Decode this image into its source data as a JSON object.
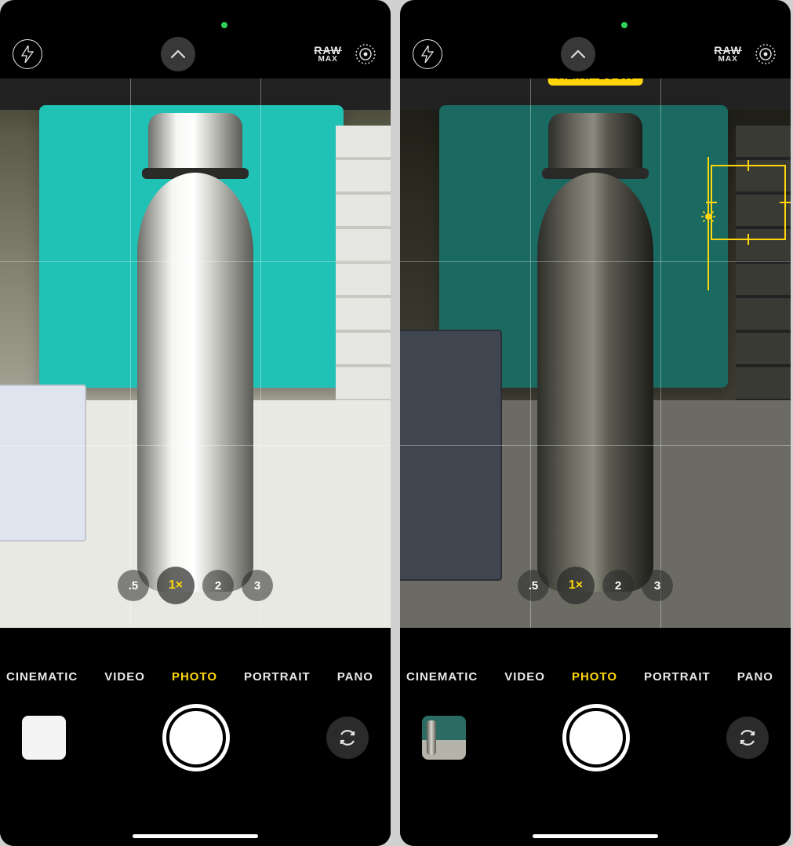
{
  "left": {
    "raw_top": "RAW",
    "raw_bottom": "MAX",
    "zoom": [
      ".5",
      "1×",
      "2",
      "3"
    ],
    "zoom_active_index": 1,
    "modes": [
      "CINEMATIC",
      "VIDEO",
      "PHOTO",
      "PORTRAIT",
      "PANO"
    ],
    "mode_active_index": 2,
    "aeaf_lock": false
  },
  "right": {
    "raw_top": "RAW",
    "raw_bottom": "MAX",
    "aeaf_label": "AE/AF LOCK",
    "zoom": [
      ".5",
      "1×",
      "2",
      "3"
    ],
    "zoom_active_index": 1,
    "modes": [
      "CINEMATIC",
      "VIDEO",
      "PHOTO",
      "PORTRAIT",
      "PANO"
    ],
    "mode_active_index": 2,
    "aeaf_lock": true
  }
}
